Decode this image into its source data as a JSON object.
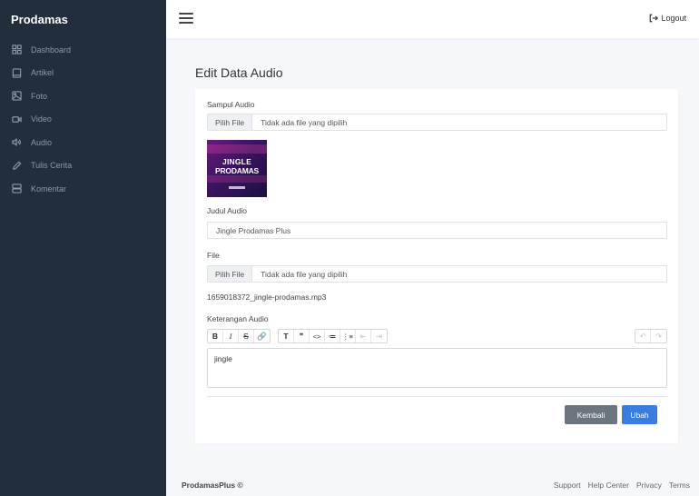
{
  "sidebar": {
    "brand": "Prodamas",
    "items": [
      {
        "label": "Dashboard",
        "icon": "grid-icon"
      },
      {
        "label": "Artikel",
        "icon": "tablet-icon"
      },
      {
        "label": "Foto",
        "icon": "image-icon"
      },
      {
        "label": "Video",
        "icon": "video-icon"
      },
      {
        "label": "Audio",
        "icon": "speaker-icon"
      },
      {
        "label": "Tulis Cerita",
        "icon": "pen-icon"
      },
      {
        "label": "Komentar",
        "icon": "server-icon"
      }
    ]
  },
  "header": {
    "logout_label": "Logout"
  },
  "page": {
    "title": "Edit Data Audio"
  },
  "form": {
    "cover_label": "Sampul Audio",
    "cover_btn": "Pilih File",
    "cover_status": "Tidak ada file yang dipilih",
    "cover_image": {
      "line1": "JINGLE",
      "line2": "PRODAMAS"
    },
    "title_label": "Judul Audio",
    "title_value": "Jingle Prodamas Plus",
    "file_label": "File",
    "file_btn": "Pilih File",
    "file_status": "Tidak ada file yang dipilih",
    "current_file": "1659018372_jingle-prodamas.mp3",
    "desc_label": "Keterangan Audio",
    "desc_value": "jingle",
    "toolbar": {
      "format": [
        "B",
        "I",
        "S",
        "🔗"
      ],
      "blocks": [
        "T",
        "❞",
        "<>",
        "≔",
        "⋮≡",
        "⇤",
        "⇥"
      ],
      "history": [
        "↶",
        "↷"
      ]
    },
    "back_btn": "Kembali",
    "save_btn": "Ubah"
  },
  "footer": {
    "brand": "ProdamasPlus ©",
    "links": [
      "Support",
      "Help Center",
      "Privacy",
      "Terms"
    ]
  },
  "colors": {
    "sidebar": "#222e3c",
    "primary": "#3b7ddd",
    "secondary": "#6c757d"
  }
}
